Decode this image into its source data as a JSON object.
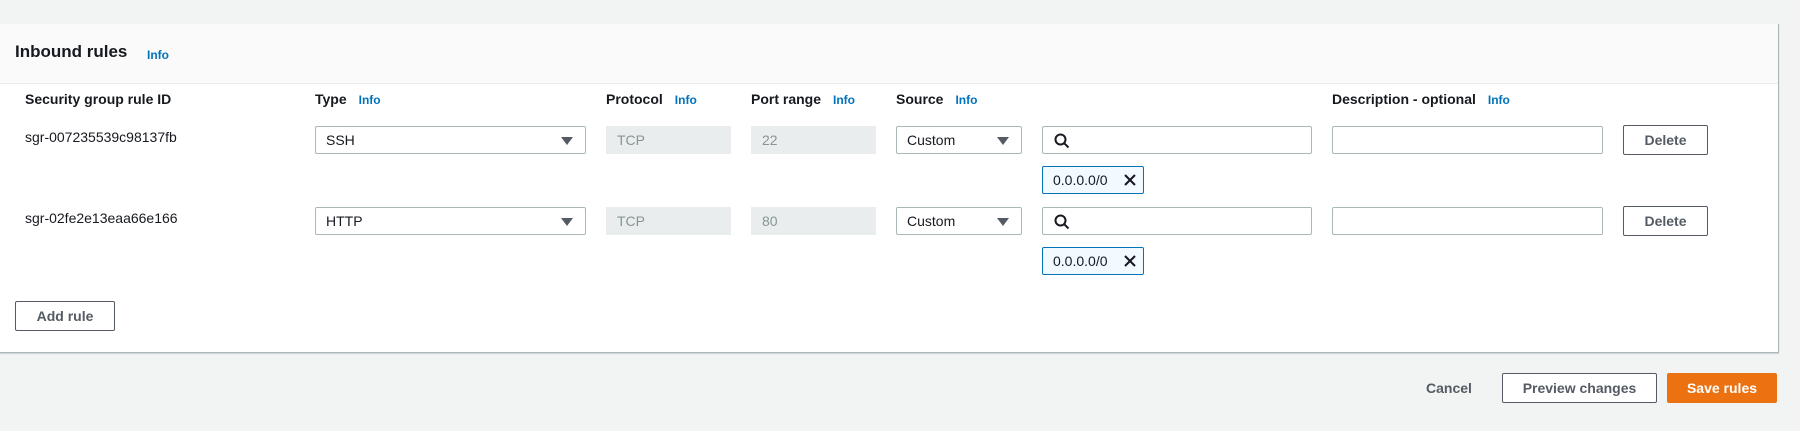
{
  "panel": {
    "title": "Inbound rules",
    "title_info": "Info"
  },
  "columns": {
    "rule_id": "Security group rule ID",
    "type": "Type",
    "type_info": "Info",
    "protocol": "Protocol",
    "protocol_info": "Info",
    "port_range": "Port range",
    "port_range_info": "Info",
    "source": "Source",
    "source_info": "Info",
    "description": "Description - optional",
    "description_info": "Info"
  },
  "rules": [
    {
      "id": "sgr-007235539c98137fb",
      "type": "SSH",
      "protocol": "TCP",
      "port_range": "22",
      "source_type": "Custom",
      "source_search_value": "",
      "source_token": "0.0.0.0/0",
      "description_value": "",
      "delete_label": "Delete"
    },
    {
      "id": "sgr-02fe2e13eaa66e166",
      "type": "HTTP",
      "protocol": "TCP",
      "port_range": "80",
      "source_type": "Custom",
      "source_search_value": "",
      "source_token": "0.0.0.0/0",
      "description_value": "",
      "delete_label": "Delete"
    }
  ],
  "add_rule_label": "Add rule",
  "footer": {
    "cancel_label": "Cancel",
    "preview_label": "Preview changes",
    "save_label": "Save rules"
  },
  "icons": {
    "search": "search-icon",
    "close": "close-icon",
    "dropdown": "caret-down-icon"
  },
  "colors": {
    "primary": "#ec7211",
    "link": "#0073bb",
    "token_border": "#0073bb",
    "background": "#f2f3f3"
  }
}
